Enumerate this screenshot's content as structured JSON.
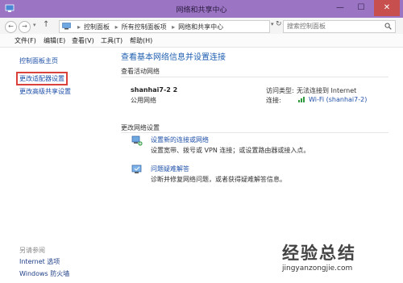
{
  "window": {
    "title": "网络和共享中心",
    "controls": {
      "minimize": "—",
      "maximize": "☐",
      "close": "✕"
    }
  },
  "address_bar": {
    "breadcrumbs": [
      "控制面板",
      "所有控制面板项",
      "网络和共享中心"
    ],
    "search_placeholder": "搜索控制面板"
  },
  "menu": {
    "items": [
      "文件(F)",
      "编辑(E)",
      "查看(V)",
      "工具(T)",
      "帮助(H)"
    ]
  },
  "sidebar": {
    "items": [
      {
        "label": "控制面板主页"
      },
      {
        "label": "更改适配器设置",
        "highlighted": true
      },
      {
        "label": "更改高级共享设置"
      }
    ],
    "see_also_title": "另请参阅",
    "see_also_items": [
      "Internet 选项",
      "Windows 防火墙"
    ]
  },
  "main": {
    "title": "查看基本网络信息并设置连接",
    "active_networks_label": "查看活动网络",
    "network": {
      "name": "shanhai7-2  2",
      "type": "公用网络",
      "access_type_label": "访问类型:",
      "access_type_value": "无法连接到 Internet",
      "connections_label": "连接:",
      "connection_value": "Wi-Fi (shanhai7-2)"
    },
    "change_settings_label": "更改网络设置",
    "tasks": [
      {
        "title": "设置新的连接或网络",
        "description": "设置宽带、拨号或 VPN 连接；或设置路由器或接入点。"
      },
      {
        "title": "问题疑难解答",
        "description": "诊断并修复网络问题，或者获得疑难解答信息。"
      }
    ]
  },
  "watermark": {
    "logo_text": "经验总结",
    "url": "jingyanzongjie.com"
  },
  "colors": {
    "titlebar": "#9b75c4",
    "link": "#1f50a8",
    "title_blue": "#1f5fb0",
    "highlight_border": "#d9413a",
    "close_button": "#c7504f"
  }
}
